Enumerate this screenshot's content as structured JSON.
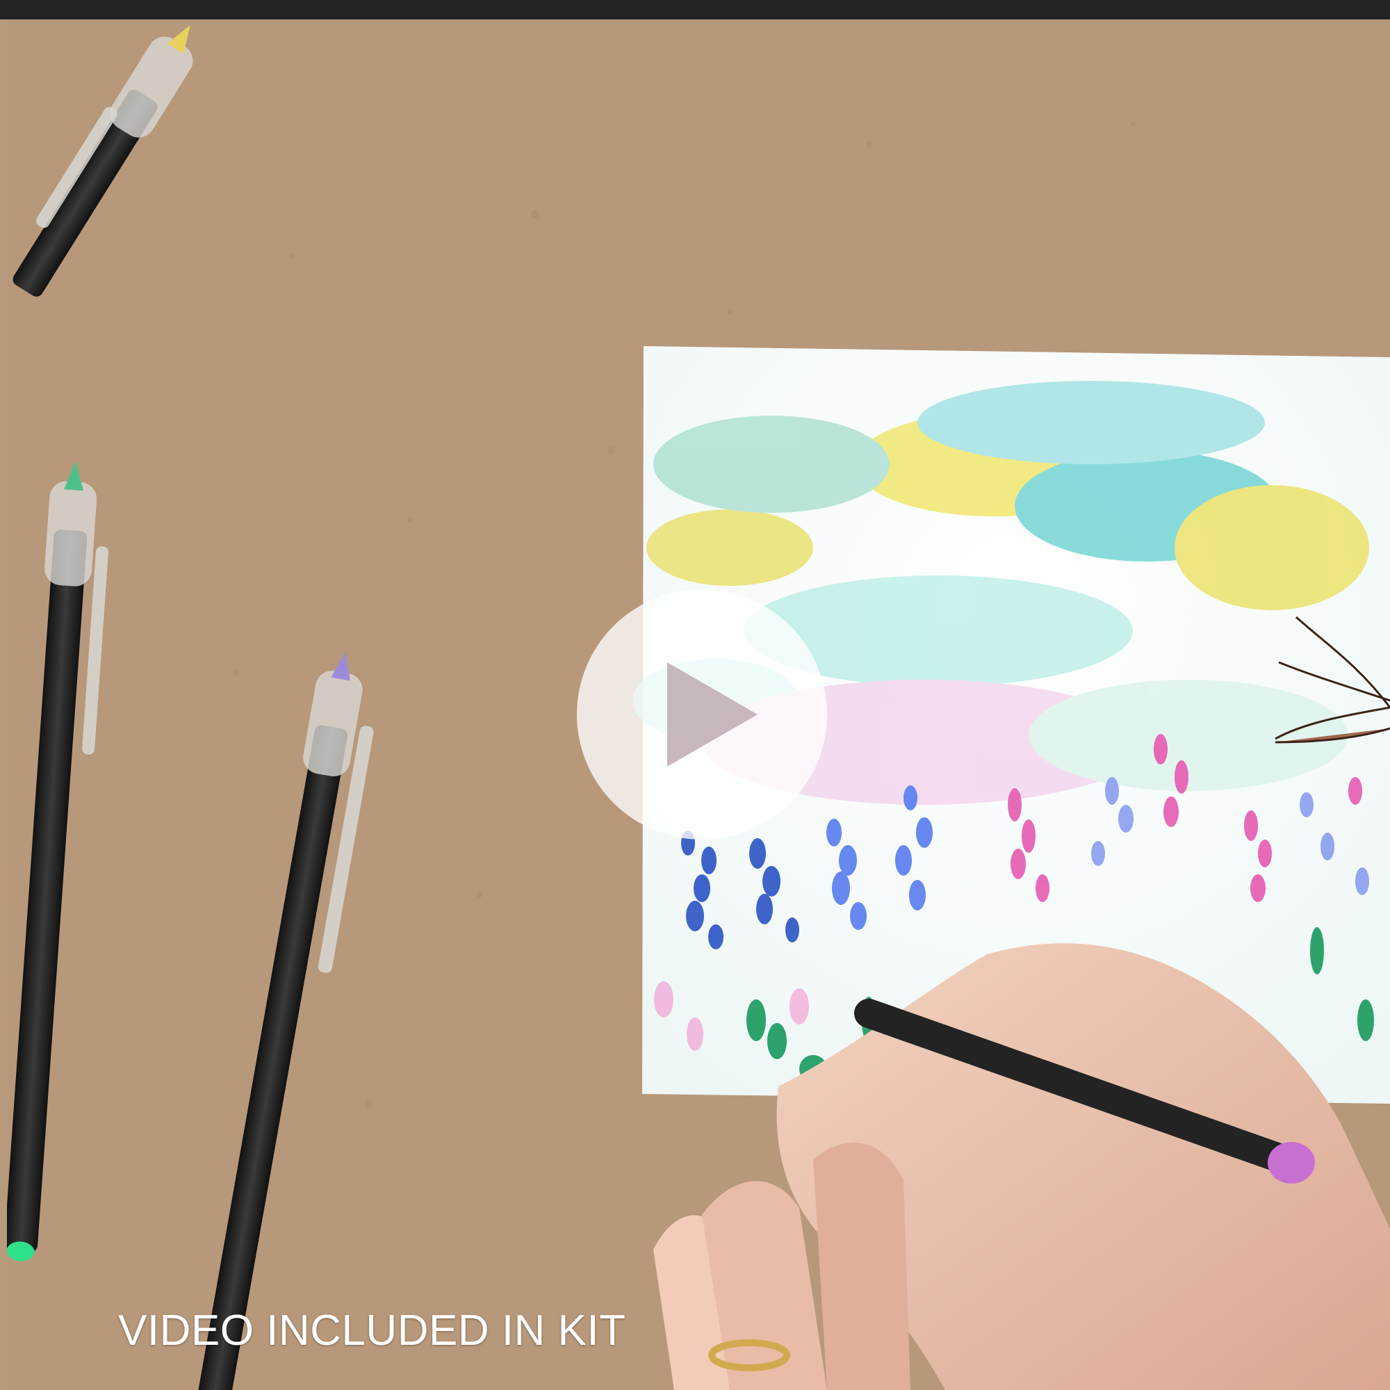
{
  "video": {
    "caption": "VIDEO INCLUDED IN KIT",
    "play_icon": "play-icon"
  },
  "colors": {
    "background": "#b7987a",
    "top_bar": "#242424",
    "caption": "#ffffff",
    "play_button": "#ffffff"
  },
  "scene": {
    "marker_colors": [
      "#e6d25c",
      "#4fbf8a",
      "#9d8bd7",
      "#c86fd2"
    ],
    "painting_palette": [
      "#5b7ff0",
      "#2f57c6",
      "#e65eb3",
      "#7dd1d8",
      "#f2e55f",
      "#4b9e5b"
    ]
  }
}
